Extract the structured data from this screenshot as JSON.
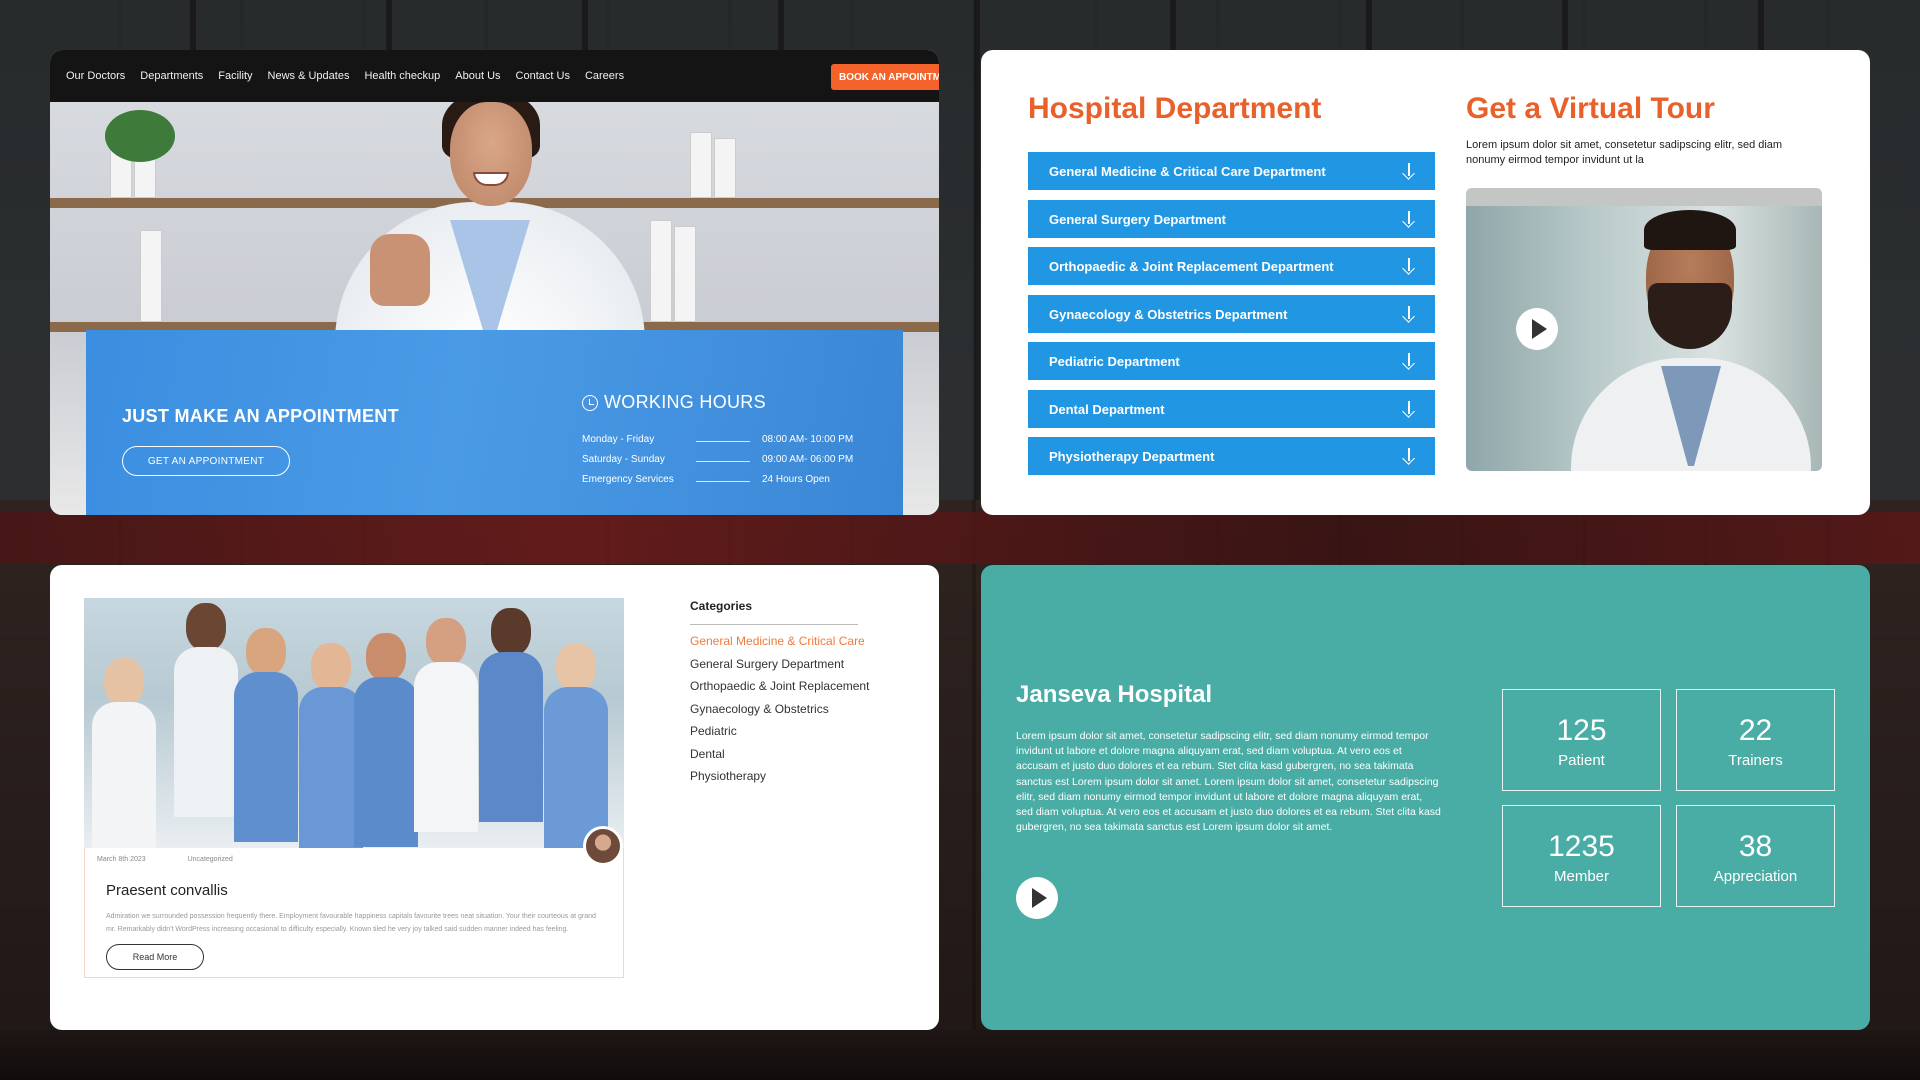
{
  "hero": {
    "nav": [
      "Our Doctors",
      "Departments",
      "Facility",
      "News & Updates",
      "Health checkup",
      "About Us",
      "Contact Us",
      "Careers"
    ],
    "book_button": "BOOK AN APPOINTM",
    "appointment_title": "JUST MAKE AN APPOINTMENT",
    "appointment_button": "GET AN APPOINTMENT",
    "working_hours_title": "WORKING HOURS",
    "hours": [
      {
        "day": "Monday - Friday",
        "time": "08:00 AM- 10:00 PM"
      },
      {
        "day": "Saturday - Sunday",
        "time": "09:00 AM- 06:00 PM"
      },
      {
        "day": "Emergency Services",
        "time": "24 Hours Open"
      }
    ],
    "colors": {
      "accent": "#f2622a",
      "blue": "#3b8ee0"
    }
  },
  "departments": {
    "title": "Hospital Department",
    "items": [
      "General Medicine & Critical Care Department",
      "General Surgery Department",
      "Orthopaedic & Joint Replacement Department",
      "Gynaecology & Obstetrics Department",
      "Pediatric Department",
      "Dental Department",
      "Physiotherapy Department"
    ],
    "virtual_tour": {
      "title": "Get a Virtual Tour",
      "text": "Lorem ipsum dolor sit amet, consetetur sadipscing elitr, sed diam nonumy eirmod tempor invidunt ut la"
    },
    "colors": {
      "title": "#e8602a",
      "row": "#2196e3"
    }
  },
  "blog": {
    "date": "March 8th 2023",
    "category": "Uncategorized",
    "title": "Praesent convallis",
    "excerpt": "Admiration we surrounded possession frequently there. Employment favourable happiness capitals favourite trees neat situation. Your their courteous at grand mr. Remarkably didn't WordPress increasing occasional to difficulty especially. Known tiled he very joy talked said sudden manner indeed has feeling.",
    "read_more": "Read More",
    "categories_title": "Categories",
    "categories": [
      "General Medicine & Critical Care",
      "General Surgery Department",
      "Orthopaedic & Joint Replacement",
      "Gynaecology & Obstetrics",
      "Pediatric",
      "Dental",
      "Physiotherapy"
    ]
  },
  "stats": {
    "title": "Janseva Hospital",
    "text": "Lorem ipsum dolor sit amet, consetetur sadipscing elitr, sed diam nonumy eirmod tempor invidunt ut labore et dolore magna aliquyam erat, sed diam voluptua. At vero eos et accusam et justo duo dolores et ea rebum. Stet clita kasd gubergren, no sea takimata sanctus est Lorem ipsum dolor sit amet. Lorem ipsum dolor sit amet, consetetur sadipscing elitr, sed diam nonumy eirmod tempor invidunt ut labore et dolore magna aliquyam erat, sed diam voluptua. At vero eos et accusam et justo duo dolores et ea rebum. Stet clita kasd gubergren, no sea takimata sanctus est Lorem ipsum dolor sit amet.",
    "items": [
      {
        "value": "125",
        "label": "Patient"
      },
      {
        "value": "22",
        "label": "Trainers"
      },
      {
        "value": "1235",
        "label": "Member"
      },
      {
        "value": "38",
        "label": "Appreciation"
      }
    ],
    "colors": {
      "background": "#49ada6"
    }
  }
}
